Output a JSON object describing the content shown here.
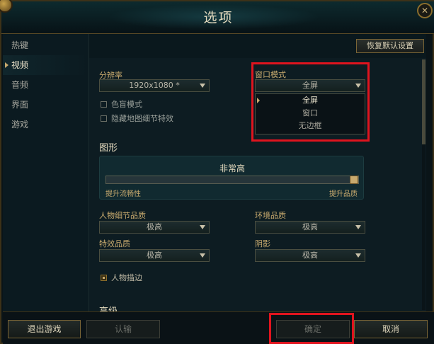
{
  "window": {
    "title": "选项",
    "close_symbol": "✕"
  },
  "sidebar": {
    "items": [
      {
        "label": "热键",
        "active": false
      },
      {
        "label": "视频",
        "active": true
      },
      {
        "label": "音频",
        "active": false
      },
      {
        "label": "界面",
        "active": false
      },
      {
        "label": "游戏",
        "active": false
      }
    ]
  },
  "header": {
    "restore_defaults": "恢复默认设置"
  },
  "video": {
    "resolution_label": "分辨率",
    "resolution_value": "1920x1080 *",
    "colorblind_label": "色盲模式",
    "hide_details_label": "隐藏地图细节特效",
    "window_mode_label": "窗口模式",
    "window_mode_value": "全屏",
    "window_mode_options": [
      "全屏",
      "窗口",
      "无边框"
    ],
    "window_mode_selected_index": 0
  },
  "graphics": {
    "section_title": "图形",
    "quality_title": "非常高",
    "slider_min_label": "提升流畅性",
    "slider_max_label": "提升品质",
    "slider_level": 1.0,
    "character_quality_label": "人物细节品质",
    "character_quality_value": "极高",
    "environment_quality_label": "环境品质",
    "environment_quality_value": "极高",
    "effects_quality_label": "特效品质",
    "effects_quality_value": "极高",
    "shadows_label": "阴影",
    "shadows_value": "极高",
    "character_outline_label": "人物描边",
    "character_outline_checked": true
  },
  "advanced": {
    "section_title": "高级"
  },
  "footer": {
    "exit_game": "退出游戏",
    "surrender": "认输",
    "confirm": "确定",
    "cancel": "取消"
  },
  "colors": {
    "accent": "#c8aa6e",
    "highlight_box": "#e0141e",
    "background": "#0d1c22"
  }
}
